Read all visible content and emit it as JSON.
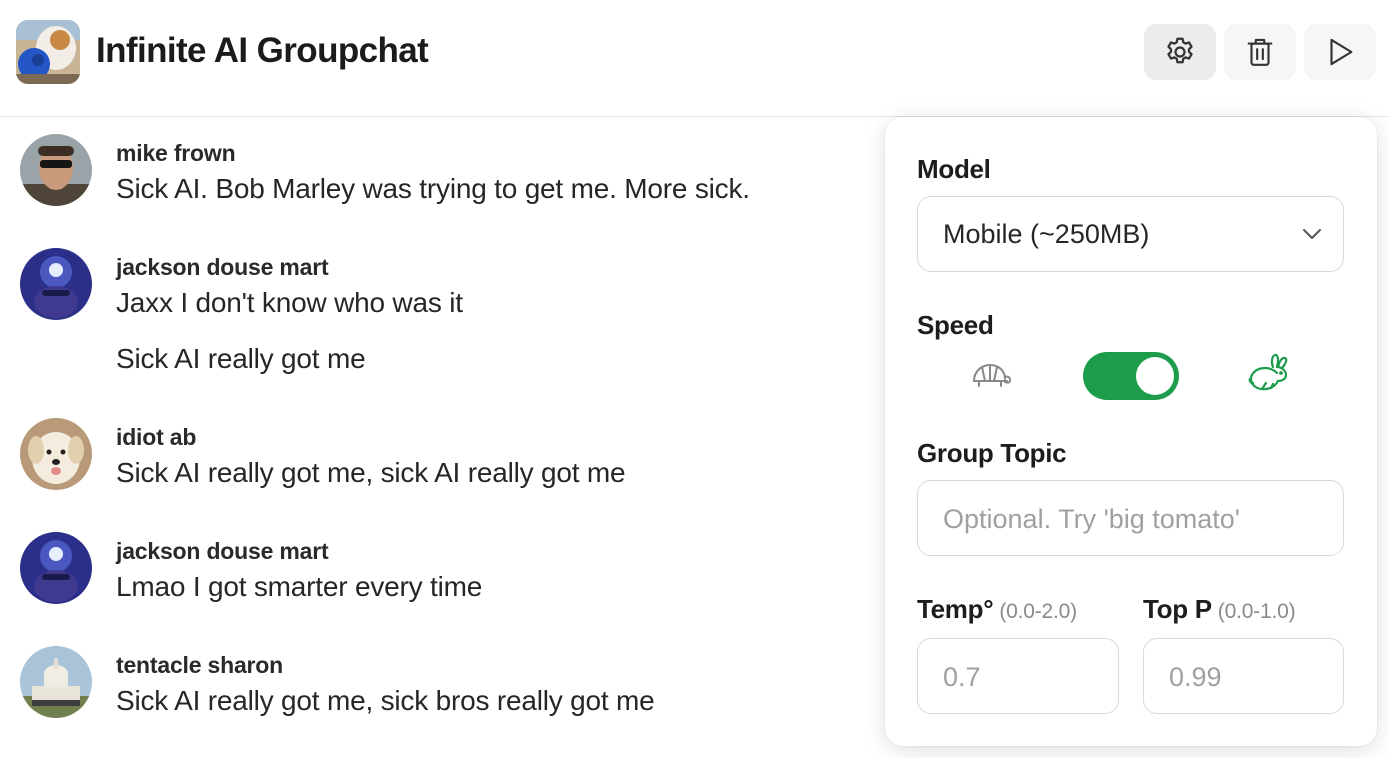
{
  "app": {
    "title": "Infinite AI Groupchat",
    "logo_icon": "dog-with-ball-avatar",
    "actions": [
      {
        "name": "settings",
        "icon": "gear-icon"
      },
      {
        "name": "delete",
        "icon": "trash-icon"
      },
      {
        "name": "play",
        "icon": "play-icon"
      }
    ]
  },
  "messages": [
    {
      "sender": "mike frown",
      "avatar": "man-with-sunglasses",
      "lines": [
        "Sick AI. Bob Marley was trying to get me. More sick."
      ]
    },
    {
      "sender": "jackson douse mart",
      "avatar": "blue-light-face",
      "lines": [
        "Jaxx I don't know who was it",
        "Sick AI really got me"
      ]
    },
    {
      "sender": "idiot ab",
      "avatar": "puppy",
      "lines": [
        "Sick AI really got me, sick AI really got me"
      ]
    },
    {
      "sender": "jackson douse mart",
      "avatar": "blue-light-face",
      "lines": [
        "Lmao I got smarter every time"
      ]
    },
    {
      "sender": "tentacle sharon",
      "avatar": "capitol-building",
      "lines": [
        "Sick AI really got me, sick bros really got me"
      ]
    }
  ],
  "settings": {
    "model_label": "Model",
    "model_value": "Mobile (~250MB)",
    "speed_label": "Speed",
    "speed_slow_icon": "turtle-icon",
    "speed_fast_icon": "rabbit-icon",
    "speed_fast_enabled": true,
    "accent_color": "#1d9d4b",
    "topic_label": "Group Topic",
    "topic_placeholder": "Optional. Try 'big tomato'",
    "topic_value": "",
    "temp_label": "Temp°",
    "temp_range": "(0.0-2.0)",
    "temp_placeholder": "0.7",
    "topp_label": "Top P",
    "topp_range": "(0.0-1.0)",
    "topp_placeholder": "0.99"
  }
}
